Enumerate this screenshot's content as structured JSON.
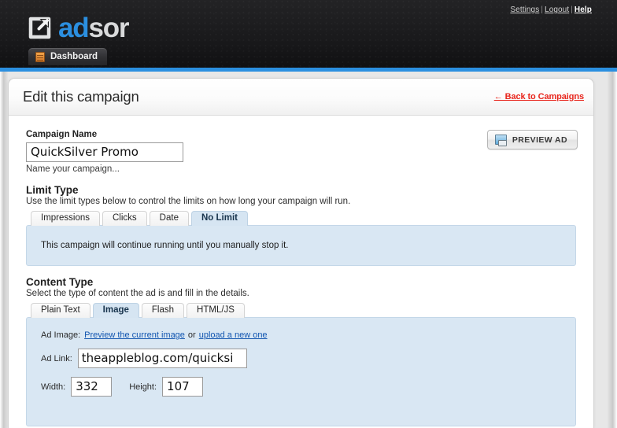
{
  "header": {
    "logo": {
      "mark_icon": "external-link-square-icon",
      "text_primary": "ad",
      "text_secondary": "sor"
    },
    "nav": [
      {
        "label": "Settings"
      },
      {
        "label": "Logout"
      },
      {
        "label": "Help"
      }
    ],
    "separator": "|",
    "tab": {
      "label": "Dashboard",
      "icon": "server-list-icon"
    },
    "accent_color": "#2b8fe0"
  },
  "page": {
    "title": "Edit this campaign",
    "back_link": "← Back to Campaigns",
    "back_link_color": "#e8261d"
  },
  "preview_button": {
    "label": "PREVIEW AD",
    "icon": "image-icon"
  },
  "campaign_name": {
    "label": "Campaign Name",
    "value": "QuickSilver Promo",
    "helper": "Name your campaign..."
  },
  "limit_type": {
    "title": "Limit Type",
    "description": "Use the limit types below to control the limits on how long your campaign will run.",
    "tabs": [
      {
        "label": "Impressions",
        "active": false
      },
      {
        "label": "Clicks",
        "active": false
      },
      {
        "label": "Date",
        "active": false
      },
      {
        "label": "No Limit",
        "active": true
      }
    ],
    "panel_text": "This campaign will continue running until you manually stop it."
  },
  "content_type": {
    "title": "Content Type",
    "description": "Select the type of content the ad is and fill in the details.",
    "tabs": [
      {
        "label": "Plain Text",
        "active": false
      },
      {
        "label": "Image",
        "active": true
      },
      {
        "label": "Flash",
        "active": false
      },
      {
        "label": "HTML/JS",
        "active": false
      }
    ],
    "ad_image": {
      "label": "Ad Image:",
      "preview_link": "Preview the current image",
      "conjunction": "or",
      "upload_link": "upload a new one"
    },
    "ad_link": {
      "label": "Ad Link:",
      "value": "theappleblog.com/quicksi"
    },
    "width": {
      "label": "Width:",
      "value": "332"
    },
    "height": {
      "label": "Height:",
      "value": "107"
    }
  }
}
